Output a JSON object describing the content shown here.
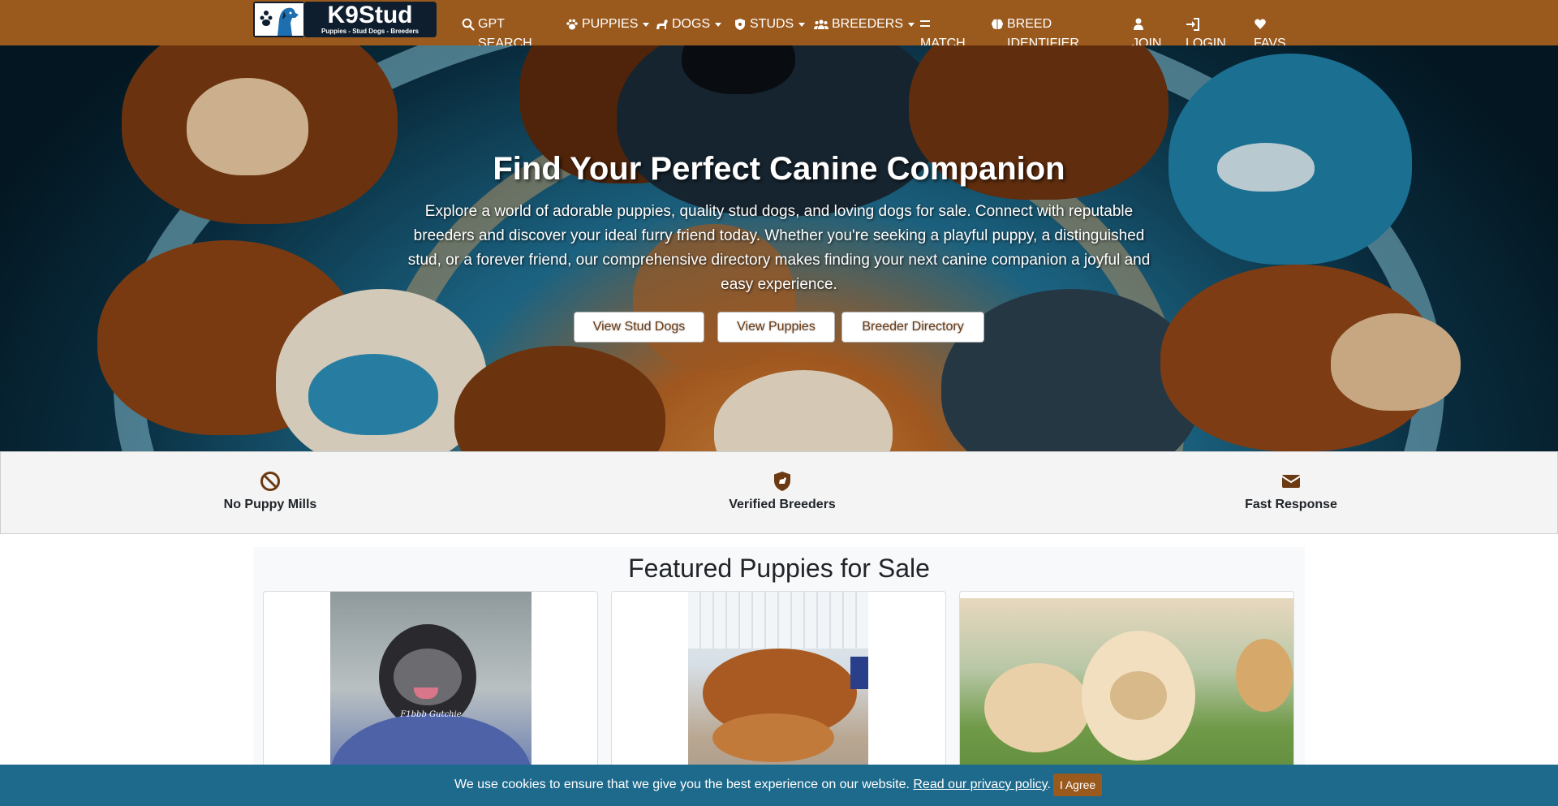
{
  "brand": {
    "title": "K9Stud",
    "tagline": "Puppies - Stud Dogs - Breeders",
    "colors": {
      "nav": "#9a5a1e",
      "dark": "#0f1e2e",
      "cookie_bar": "#1d6a8c",
      "accent_text": "#6b3a12"
    }
  },
  "nav": {
    "gpt_search": "GPT SEARCH",
    "puppies": "PUPPIES",
    "dogs": "DOGS",
    "studs": "STUDS",
    "breeders": "BREEDERS",
    "match": "MATCH",
    "breed_identifier": "BREED IDENTIFIER",
    "join": "JOIN",
    "login": "LOGIN",
    "favs": "FAVS",
    "icons": [
      "search-icon",
      "paw-icon",
      "dog-icon",
      "shield-icon",
      "users-icon",
      "equals-icon",
      "brain-icon",
      "user-icon",
      "sign-in-icon",
      "heart-icon"
    ]
  },
  "hero": {
    "title": "Find Your Perfect Canine Companion",
    "text": "Explore a world of adorable puppies, quality stud dogs, and loving dogs for sale. Connect with reputable breeders and discover your ideal furry friend today. Whether you're seeking a playful puppy, a distinguished stud, or a forever friend, our comprehensive directory makes finding your next canine companion a joyful and easy experience.",
    "buttons": {
      "stud_dogs": "View Stud Dogs",
      "puppies": "View Puppies",
      "breeder_directory": "Breeder Directory"
    }
  },
  "features": [
    {
      "label": "No Puppy Mills",
      "icon": "ban-icon"
    },
    {
      "label": "Verified Breeders",
      "icon": "shield-dog-icon"
    },
    {
      "label": "Fast Response",
      "icon": "envelope-icon"
    }
  ],
  "featured": {
    "title": "Featured Puppies for Sale",
    "cards": [
      {
        "image_caption": "F1bbb Gutchie"
      },
      {
        "image_caption": ""
      },
      {
        "image_caption": ""
      }
    ]
  },
  "cookie": {
    "text": "We use cookies to ensure that we give you the best experience on our website.",
    "link": "Read our privacy policy",
    "period": ".",
    "button": "I Agree"
  }
}
